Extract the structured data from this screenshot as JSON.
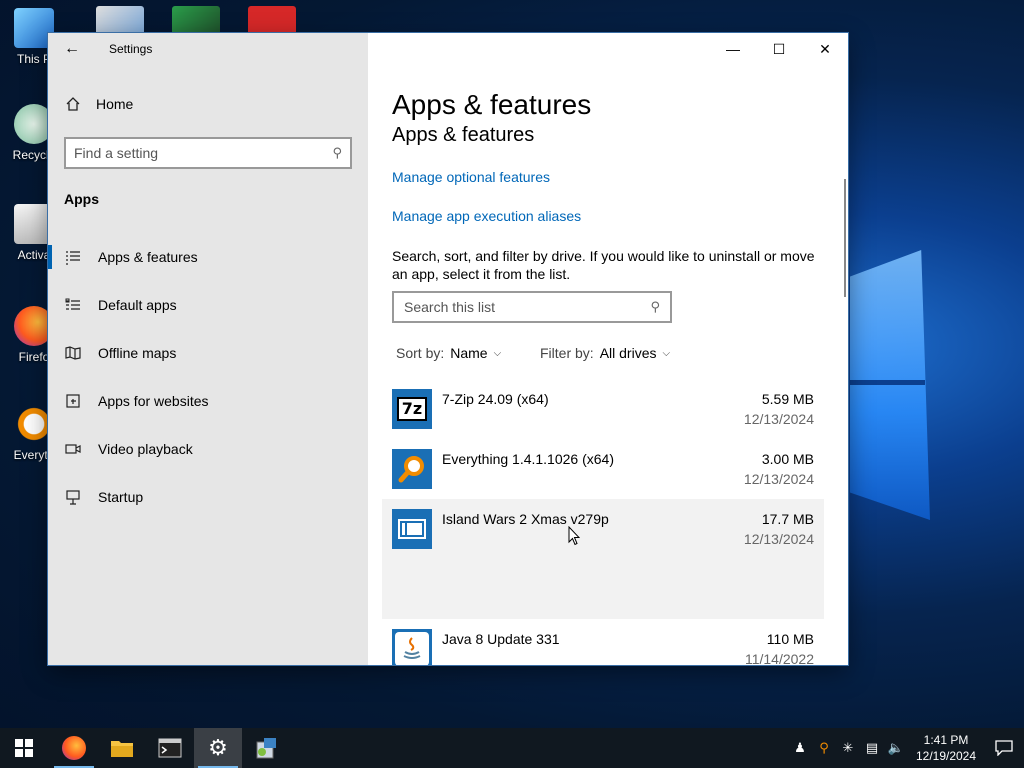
{
  "desktop": {
    "icons": [
      {
        "label": "This P",
        "icon": "this-pc-icon"
      },
      {
        "label": "Recycle",
        "icon": "recycle-bin-icon"
      },
      {
        "label": "Activa",
        "icon": "activation-icon"
      },
      {
        "label": "Firefo",
        "icon": "firefox-icon"
      },
      {
        "label": "Everyth",
        "icon": "everything-search-icon"
      }
    ]
  },
  "window": {
    "title": "Settings",
    "controls": {
      "minimize": "—",
      "maximize": "☐",
      "close": "✕"
    }
  },
  "sidebar": {
    "home_label": "Home",
    "search_placeholder": "Find a setting",
    "section": "Apps",
    "items": [
      {
        "label": "Apps & features",
        "icon": "apps-list-icon",
        "active": true
      },
      {
        "label": "Default apps",
        "icon": "default-apps-icon",
        "active": false
      },
      {
        "label": "Offline maps",
        "icon": "map-icon",
        "active": false
      },
      {
        "label": "Apps for websites",
        "icon": "web-app-icon",
        "active": false
      },
      {
        "label": "Video playback",
        "icon": "video-icon",
        "active": false
      },
      {
        "label": "Startup",
        "icon": "startup-icon",
        "active": false
      }
    ]
  },
  "main": {
    "heading": "Apps & features",
    "subheading": "Apps & features",
    "links": {
      "optional_features": "Manage optional features",
      "execution_aliases": "Manage app execution aliases"
    },
    "description": "Search, sort, and filter by drive. If you would like to uninstall or move an app, select it from the list.",
    "list_search_placeholder": "Search this list",
    "sort": {
      "label": "Sort by:",
      "value": "Name"
    },
    "filter": {
      "label": "Filter by:",
      "value": "All drives"
    },
    "apps": [
      {
        "name": "7-Zip 24.09 (x64)",
        "size": "5.59 MB",
        "date": "12/13/2024",
        "icon": "7zip-icon",
        "selected": false
      },
      {
        "name": "Everything 1.4.1.1026 (x64)",
        "size": "3.00 MB",
        "date": "12/13/2024",
        "icon": "everything-icon",
        "selected": false
      },
      {
        "name": "Island Wars 2 Xmas v279p",
        "size": "17.7 MB",
        "date": "12/13/2024",
        "icon": "generic-app-icon",
        "selected": true
      },
      {
        "name": "Java 8 Update 331",
        "size": "110 MB",
        "date": "11/14/2022",
        "icon": "java-icon",
        "selected": false
      }
    ]
  },
  "taskbar": {
    "apps": [
      "start-icon",
      "firefox-icon",
      "file-explorer-icon",
      "terminal-icon",
      "settings-icon",
      "installer-icon"
    ],
    "clock_time": "1:41 PM",
    "clock_date": "12/19/2024"
  },
  "colors": {
    "accent": "#0063b1",
    "link": "#0067b8",
    "sidebar_bg": "#e6e6e6",
    "taskbar_bg": "#101820"
  }
}
